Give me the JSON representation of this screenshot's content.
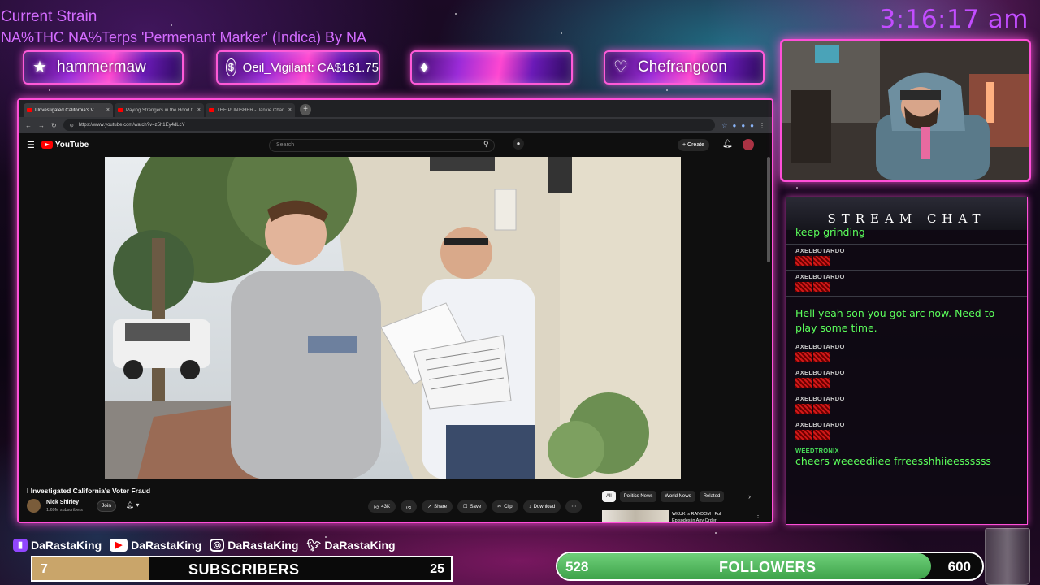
{
  "strain": {
    "title": "Current Strain",
    "line": "NA%THC NA%Terps 'Permenant Marker' (Indica) By NA"
  },
  "clock": "3:16:17 am",
  "alerts": [
    {
      "icon": "star-icon",
      "label": "hammermaw"
    },
    {
      "icon": "dollar-icon",
      "label": "Oeil_Vigilant: CA$161.75"
    },
    {
      "icon": "diamond-icon",
      "label": ""
    },
    {
      "icon": "heart-icon",
      "label": "Chefrangoon"
    }
  ],
  "browser": {
    "tabs": [
      {
        "label": "I Investigated California's V",
        "active": true
      },
      {
        "label": "Paying Strangers in the Hood t",
        "active": false
      },
      {
        "label": "THE PUNISHER - Jankie Chan I",
        "active": false
      }
    ],
    "url": "https://www.youtube.com/watch?v=z5h1Ey4dLcY"
  },
  "youtube": {
    "logo": "YouTube",
    "search_placeholder": "Search",
    "create_label": "Create",
    "video_title": "I Investigated California's Voter Fraud",
    "channel": {
      "name": "Nick Shirley",
      "subs": "1.69M subscribers"
    },
    "join_label": "Join",
    "actions": {
      "like": "43K",
      "share": "Share",
      "save": "Save",
      "clip": "Clip",
      "download": "Download"
    },
    "chips": [
      {
        "label": "All",
        "active": true
      },
      {
        "label": "Politics News",
        "active": false
      },
      {
        "label": "World News",
        "active": false
      },
      {
        "label": "Related",
        "active": false
      }
    ],
    "rec_title": "WKUK is RANDOM | Full Episodes in Any Order"
  },
  "chat": {
    "header": "STREAM CHAT",
    "messages": [
      {
        "user": "",
        "user_color": "plain",
        "text": "keep grinding",
        "emotes": 0
      },
      {
        "user": "AXELBOTARDO",
        "user_color": "plain",
        "text": "",
        "emotes": 2
      },
      {
        "user": "AXELBOTARDO",
        "user_color": "plain",
        "text": "",
        "emotes": 2
      },
      {
        "user": "",
        "user_color": "red",
        "text": "Hell yeah son you got arc now. Need to play some time.",
        "emotes": 0
      },
      {
        "user": "AXELBOTARDO",
        "user_color": "plain",
        "text": "",
        "emotes": 2
      },
      {
        "user": "AXELBOTARDO",
        "user_color": "plain",
        "text": "",
        "emotes": 2
      },
      {
        "user": "AXELBOTARDO",
        "user_color": "plain",
        "text": "",
        "emotes": 2
      },
      {
        "user": "AXELBOTARDO",
        "user_color": "plain",
        "text": "",
        "emotes": 2
      },
      {
        "user": "WEEDTRONIX",
        "user_color": "green",
        "text": "cheers weeeediiee frreesshhiieessssss",
        "emotes": 0
      }
    ]
  },
  "socials": [
    {
      "icon": "twitch-icon",
      "color": "#9146ff",
      "handle": "DaRastaKing"
    },
    {
      "icon": "youtube-icon",
      "color": "#ff0000",
      "handle": "DaRastaKing"
    },
    {
      "icon": "instagram-icon",
      "color": "#d6249f",
      "handle": "DaRastaKing"
    },
    {
      "icon": "twitter-icon",
      "color": "#1da1f2",
      "handle": "DaRastaKing"
    }
  ],
  "subscribers": {
    "current": "7",
    "label": "SUBSCRIBERS",
    "goal": "25",
    "progress": 0.28
  },
  "followers": {
    "current": "528",
    "label": "FOLLOWERS",
    "goal": "600",
    "progress": 0.88
  },
  "colors": {
    "accent": "#ff4fd8",
    "strain_text": "#d46cff",
    "clock": "#c24dff",
    "chat_green": "#5cff5c"
  }
}
